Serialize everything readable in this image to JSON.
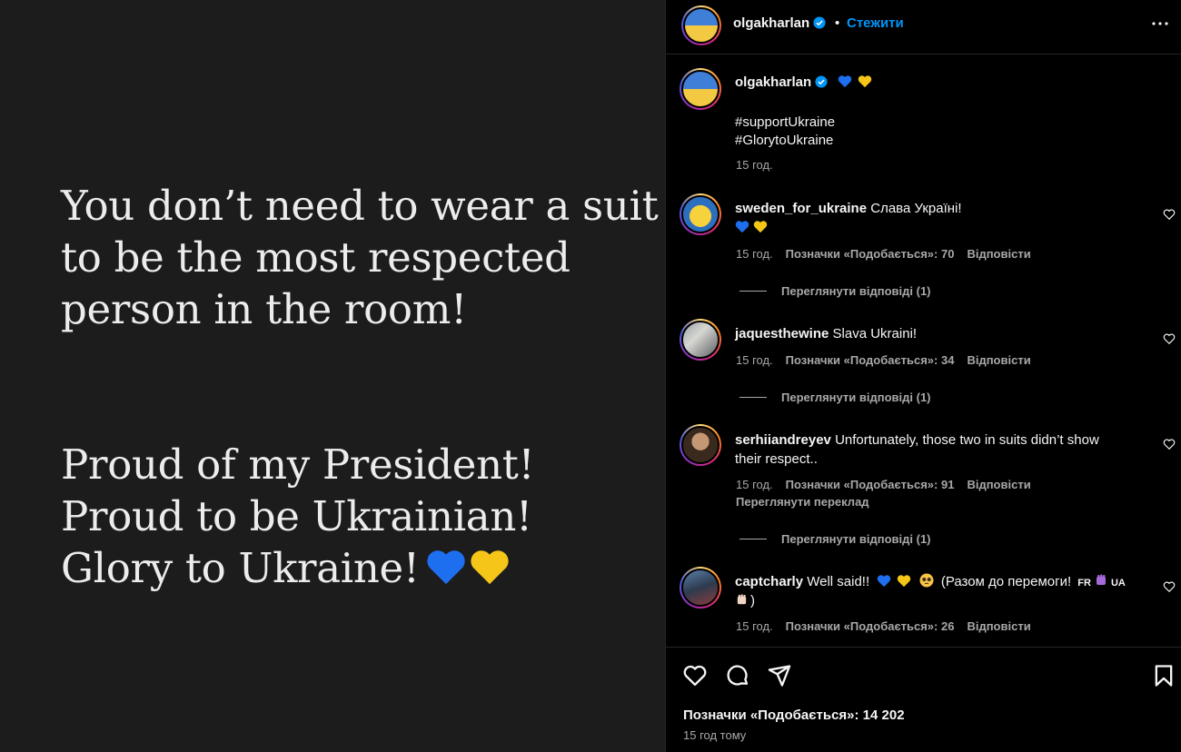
{
  "image": {
    "quote1": [
      "You don’t need to wear a suit",
      "to be the most respected",
      "person in the room!"
    ],
    "quote2": [
      "Proud of my President!",
      "Proud to be Ukrainian!",
      "Glory to Ukraine!"
    ],
    "quote2_hearts": [
      "blue-heart",
      "yellow-heart"
    ]
  },
  "header": {
    "username": "olgakharlan",
    "dot": "•",
    "follow_label": "Стежити",
    "verified": true
  },
  "caption": {
    "username": "olgakharlan",
    "hearts": [
      "blue-heart",
      "yellow-heart"
    ],
    "line1": "#supportUkraine",
    "line2": "#GlorytoUkraine",
    "time": "15 год."
  },
  "comments": [
    {
      "username": "sweden_for_ukraine",
      "text": "Слава Україні!",
      "time": "15 год.",
      "likes": "Позначки «Подобається»: 70",
      "reply": "Відповісти",
      "view_replies": "Переглянути відповіді (1)"
    },
    {
      "username": "jaquesthewine",
      "text": "Slava Ukraini!",
      "time": "15 год.",
      "likes": "Позначки «Подобається»: 34",
      "reply": "Відповісти",
      "view_replies": "Переглянути відповіді (1)"
    },
    {
      "username": "serhiiandreyev",
      "text_line1": "Unfortunately, those two in suits didn’t show",
      "text_line2": "their respect..",
      "time": "15 год.",
      "likes": "Позначки «Подобається»: 91",
      "reply": "Відповісти",
      "translate": "Переглянути переклад",
      "view_replies": "Переглянути відповіді (1)"
    },
    {
      "username": "captcharly",
      "text_part1": "Well said!!",
      "text_part2": "(Разом до перемоги!",
      "flag1": "FR",
      "flag2": "UA",
      "text_part3": ")",
      "time": "15 год.",
      "likes": "Позначки «Подобається»: 26",
      "reply": "Відповісти"
    }
  ],
  "footer": {
    "likes": "Позначки «Подобається»: 14 202",
    "time_ago": "15 год тому"
  },
  "colors": {
    "accent": "#0095f6",
    "heart_blue": "#1e6ff0",
    "heart_yellow": "#f5c518",
    "image_bg": "#1c1c1c"
  }
}
